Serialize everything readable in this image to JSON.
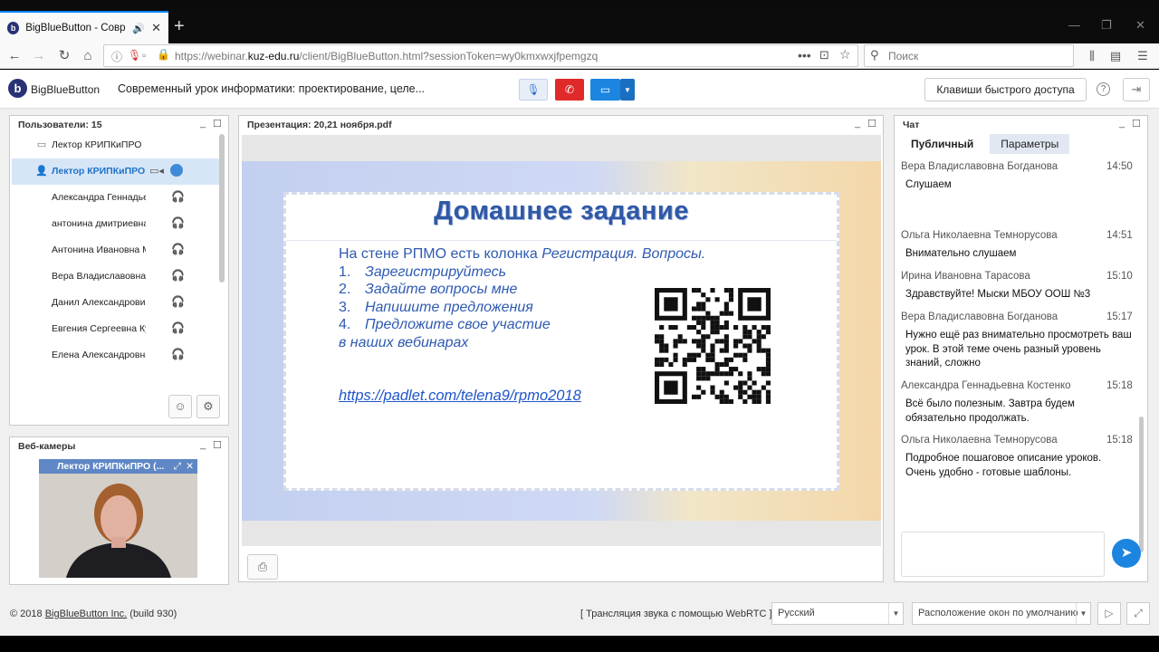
{
  "browser": {
    "tab_title": "BigBlueButton - Современный",
    "url_prefix": "https://webinar.",
    "url_domain": "kuz-edu.ru",
    "url_path": "/client/BigBlueButton.html?sessionToken=wy0kmxwxjfpemgzq",
    "search_placeholder": "Поиск"
  },
  "header": {
    "brand": "BigBlueButton",
    "meeting_title": "Современный урок информатики: проектирование, целе...",
    "shortcuts_label": "Клавиши быстрого доступа",
    "help_label": "?"
  },
  "users_panel": {
    "title": "Пользователи: 15",
    "users": [
      {
        "name": "Лектор КРИПКиПРО",
        "role": "presenter",
        "selected": false
      },
      {
        "name": "Лектор КРИПКиПРО (",
        "role": "moderator",
        "selected": true
      },
      {
        "name": "Александра Геннадьев",
        "role": "listener",
        "selected": false
      },
      {
        "name": "антонина дмитриевна",
        "role": "listener",
        "selected": false
      },
      {
        "name": "Антонина Ивановна Ма",
        "role": "listener",
        "selected": false
      },
      {
        "name": "Вера Владиславовна Б",
        "role": "listener",
        "selected": false
      },
      {
        "name": "Данил Александрови",
        "role": "listener",
        "selected": false
      },
      {
        "name": "Евгения Сергеевна Ку",
        "role": "listener",
        "selected": false
      },
      {
        "name": "Елена Александровна",
        "role": "listener",
        "selected": false
      }
    ]
  },
  "webcams_panel": {
    "title": "Веб-камеры",
    "video_label": "Лектор КРИПКиПРО (..."
  },
  "presentation_panel": {
    "title": "Презентация: 20,21 ноября.pdf",
    "slide": {
      "heading": "Домашнее задание",
      "intro_plain": "На стене РПМО есть колонка ",
      "intro_italic": "Регистрация. Вопросы.",
      "items": [
        {
          "num": "1.",
          "text": "Зарегистрируйтесь"
        },
        {
          "num": "2.",
          "text": "Задайте вопросы мне"
        },
        {
          "num": "3.",
          "text": "Напишите предложения"
        },
        {
          "num": "4.",
          "text": "Предложите свое участие"
        }
      ],
      "tail": "в наших вебинарах",
      "link": "https://padlet.com/telena9/rpmo2018"
    }
  },
  "chat_panel": {
    "title": "Чат",
    "tabs": [
      "Публичный",
      "Параметры"
    ],
    "messages": [
      {
        "sender": "Вера Владиславовна Богданова",
        "time": "14:50",
        "text": "Слушаем"
      },
      {
        "sender": "Ольга Николаевна Темнорусова",
        "time": "14:51",
        "text": "Внимательно слушаем"
      },
      {
        "sender": "Ирина Ивановна Тарасова",
        "time": "15:10",
        "text": "Здравствуйте! Мыски МБОУ ООШ №3"
      },
      {
        "sender": "Вера Владиславовна Богданова",
        "time": "15:17",
        "text": "Нужно ещё раз внимательно просмотреть ваш урок. В этой теме очень разный уровень знаний, сложно"
      },
      {
        "sender": "Александра Геннадьевна Костенко",
        "time": "15:18",
        "text": "Всё было полезным. Завтра будем обязательно продолжать."
      },
      {
        "sender": "Ольга Николаевна Темнорусова",
        "time": "15:18",
        "text": "Подробное пошаговое описание уроков. Очень удобно - готовые шаблоны."
      }
    ]
  },
  "footer": {
    "copyright_prefix": "© 2018 ",
    "copyright_link": "BigBlueButton Inc.",
    "copyright_suffix": " (build 930)",
    "audio_label": "[ Трансляция звука с помощью WebRTC ]",
    "language": "Русский",
    "layout": "Расположение окон по умолчанию"
  },
  "colors": {
    "accent": "#1b85e0",
    "hangup": "#e02a2a",
    "slide_text": "#2e5ab0"
  }
}
